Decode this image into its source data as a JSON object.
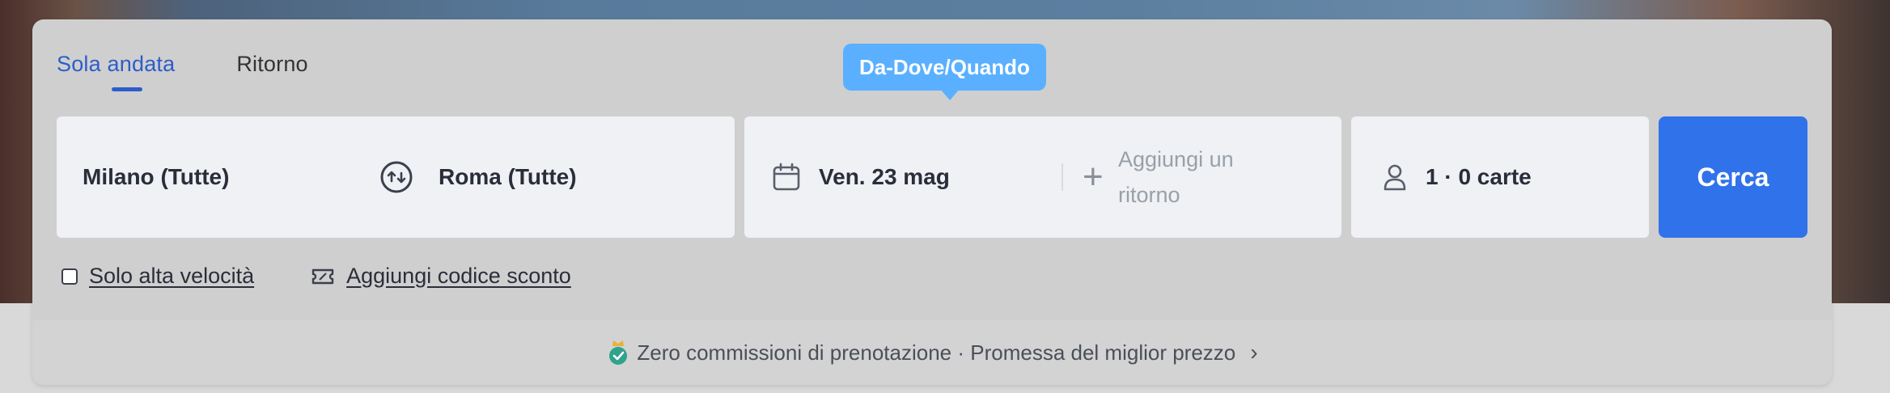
{
  "tabs": [
    {
      "label": "Sola andata",
      "active": true
    },
    {
      "label": "Ritorno",
      "active": false
    }
  ],
  "tooltip": {
    "label": "Da-Dove/Quando"
  },
  "route": {
    "from": "Milano (Tutte)",
    "to": "Roma (Tutte)",
    "swap_icon": "swap-icon"
  },
  "dates": {
    "departure": "Ven. 23 mag",
    "return_line1": "Aggiungi un",
    "return_line2": "ritorno",
    "calendar_icon": "calendar-icon",
    "plus_icon": "plus-icon"
  },
  "passengers": {
    "label": "1 · 0 carte",
    "icon": "person-icon"
  },
  "search_button": {
    "label": "Cerca"
  },
  "options": {
    "high_speed": "Solo alta velocità",
    "discount": "Aggiungi codice sconto"
  },
  "footer": {
    "text": "Zero commissioni di prenotazione · Promessa del miglior prezzo",
    "chevron": "›"
  },
  "colors": {
    "accent": "#2c5ec9",
    "button": "#3072ea",
    "tooltip": "#5ab0ff",
    "field": "#eff1f4"
  }
}
